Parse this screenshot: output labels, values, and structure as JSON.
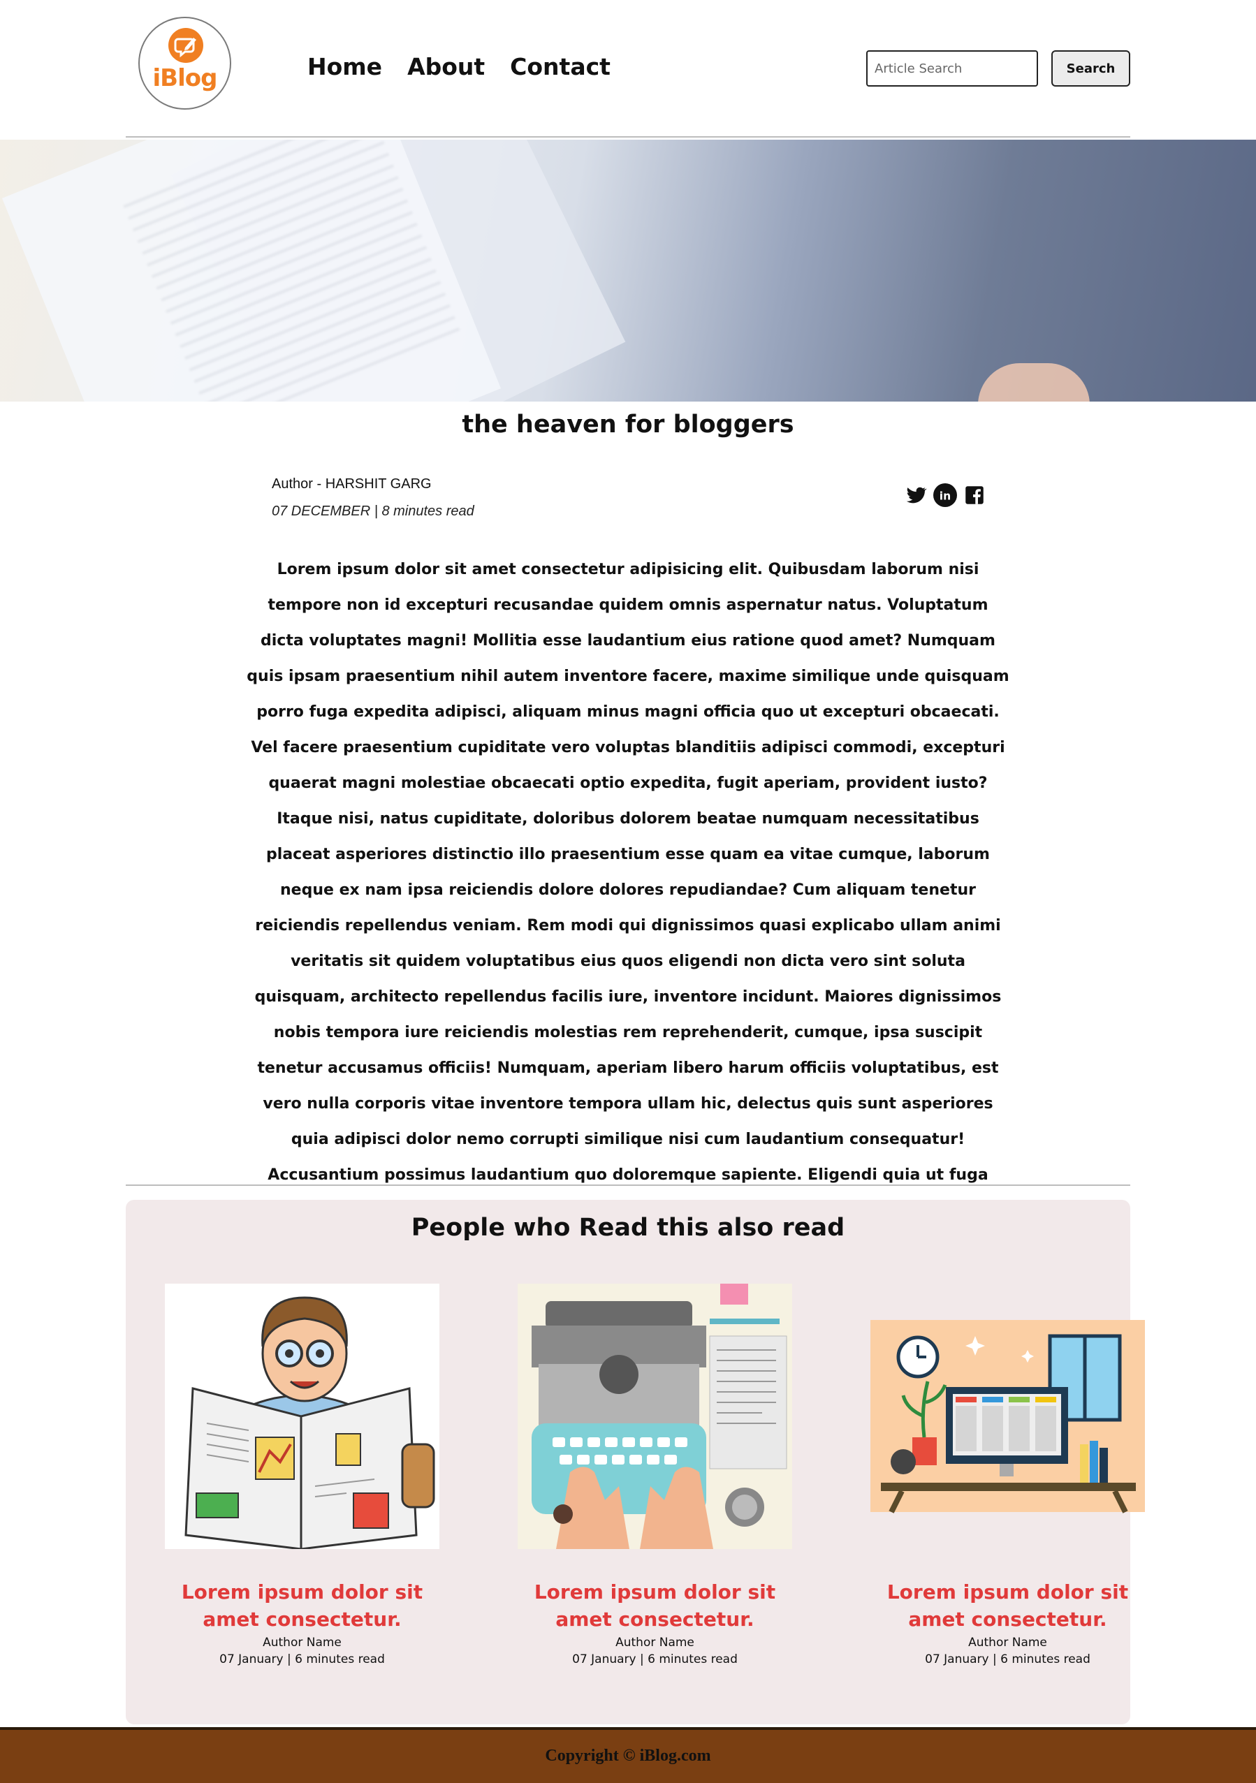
{
  "brand": {
    "name": "iBlog",
    "accent": "#f07f22"
  },
  "nav": {
    "items": [
      "Home",
      "About",
      "Contact"
    ]
  },
  "search": {
    "placeholder": "Article Search",
    "button_label": "Search"
  },
  "article": {
    "title": "the heaven for bloggers",
    "author": "Author - HARSHIT GARG",
    "date_read": "07 DECEMBER | 8 minutes read",
    "body": "Lorem ipsum dolor sit amet consectetur adipisicing elit. Quibusdam laborum nisi tempore non id excepturi recusandae quidem omnis aspernatur natus. Voluptatum dicta voluptates magni! Mollitia esse laudantium eius ratione quod amet? Numquam quis ipsam praesentium nihil autem inventore facere, maxime similique unde quisquam porro fuga expedita adipisci, aliquam minus magni officia quo ut excepturi obcaecati. Vel facere praesentium cupiditate vero voluptas blanditiis adipisci commodi, excepturi quaerat magni molestiae obcaecati optio expedita, fugit aperiam, provident iusto? Itaque nisi, natus cupiditate, doloribus dolorem beatae numquam necessitatibus placeat asperiores distinctio illo praesentium esse quam ea vitae cumque, laborum neque ex nam ipsa reiciendis dolore dolores repudiandae? Cum aliquam tenetur reiciendis repellendus veniam. Rem modi qui dignissimos quasi explicabo ullam animi veritatis sit quidem voluptatibus eius quos eligendi non dicta vero sint soluta quisquam, architecto repellendus facilis iure, inventore incidunt. Maiores dignissimos nobis tempora iure reiciendis molestias rem reprehenderit, cumque, ipsa suscipit tenetur accusamus officiis! Numquam, aperiam libero harum officiis voluptatibus, est vero nulla corporis vitae inventore tempora ullam hic, delectus quis sunt asperiores quia adipisci dolor nemo corrupti similique nisi cum laudantium consequatur! Accusantium possimus laudantium quo doloremque sapiente. Eligendi quia ut fuga neque eius quaerat, tenetur consequatur magnam sit mollitia aut repudiandae?"
  },
  "social": {
    "icons": [
      "twitter-icon",
      "linkedin-icon",
      "facebook-icon"
    ]
  },
  "related": {
    "title": "People who Read this also read",
    "cards": [
      {
        "title": "Lorem ipsum dolor sit amet consectetur.",
        "author": "Author Name",
        "date_read": "07 January | 6 minutes read",
        "image": "newspaper-reader-illustration"
      },
      {
        "title": "Lorem ipsum dolor sit amet consectetur.",
        "author": "Author Name",
        "date_read": "07 January | 6 minutes read",
        "image": "typewriter-illustration"
      },
      {
        "title": "Lorem ipsum dolor sit amet consectetur.",
        "author": "Author Name",
        "date_read": "07 January | 6 minutes read",
        "image": "desk-workspace-illustration"
      }
    ],
    "background": "#f2e9ea",
    "title_color": "#e03a3a"
  },
  "footer": {
    "text": "Copyright © iBlog.com",
    "background": "#7a3f12"
  }
}
